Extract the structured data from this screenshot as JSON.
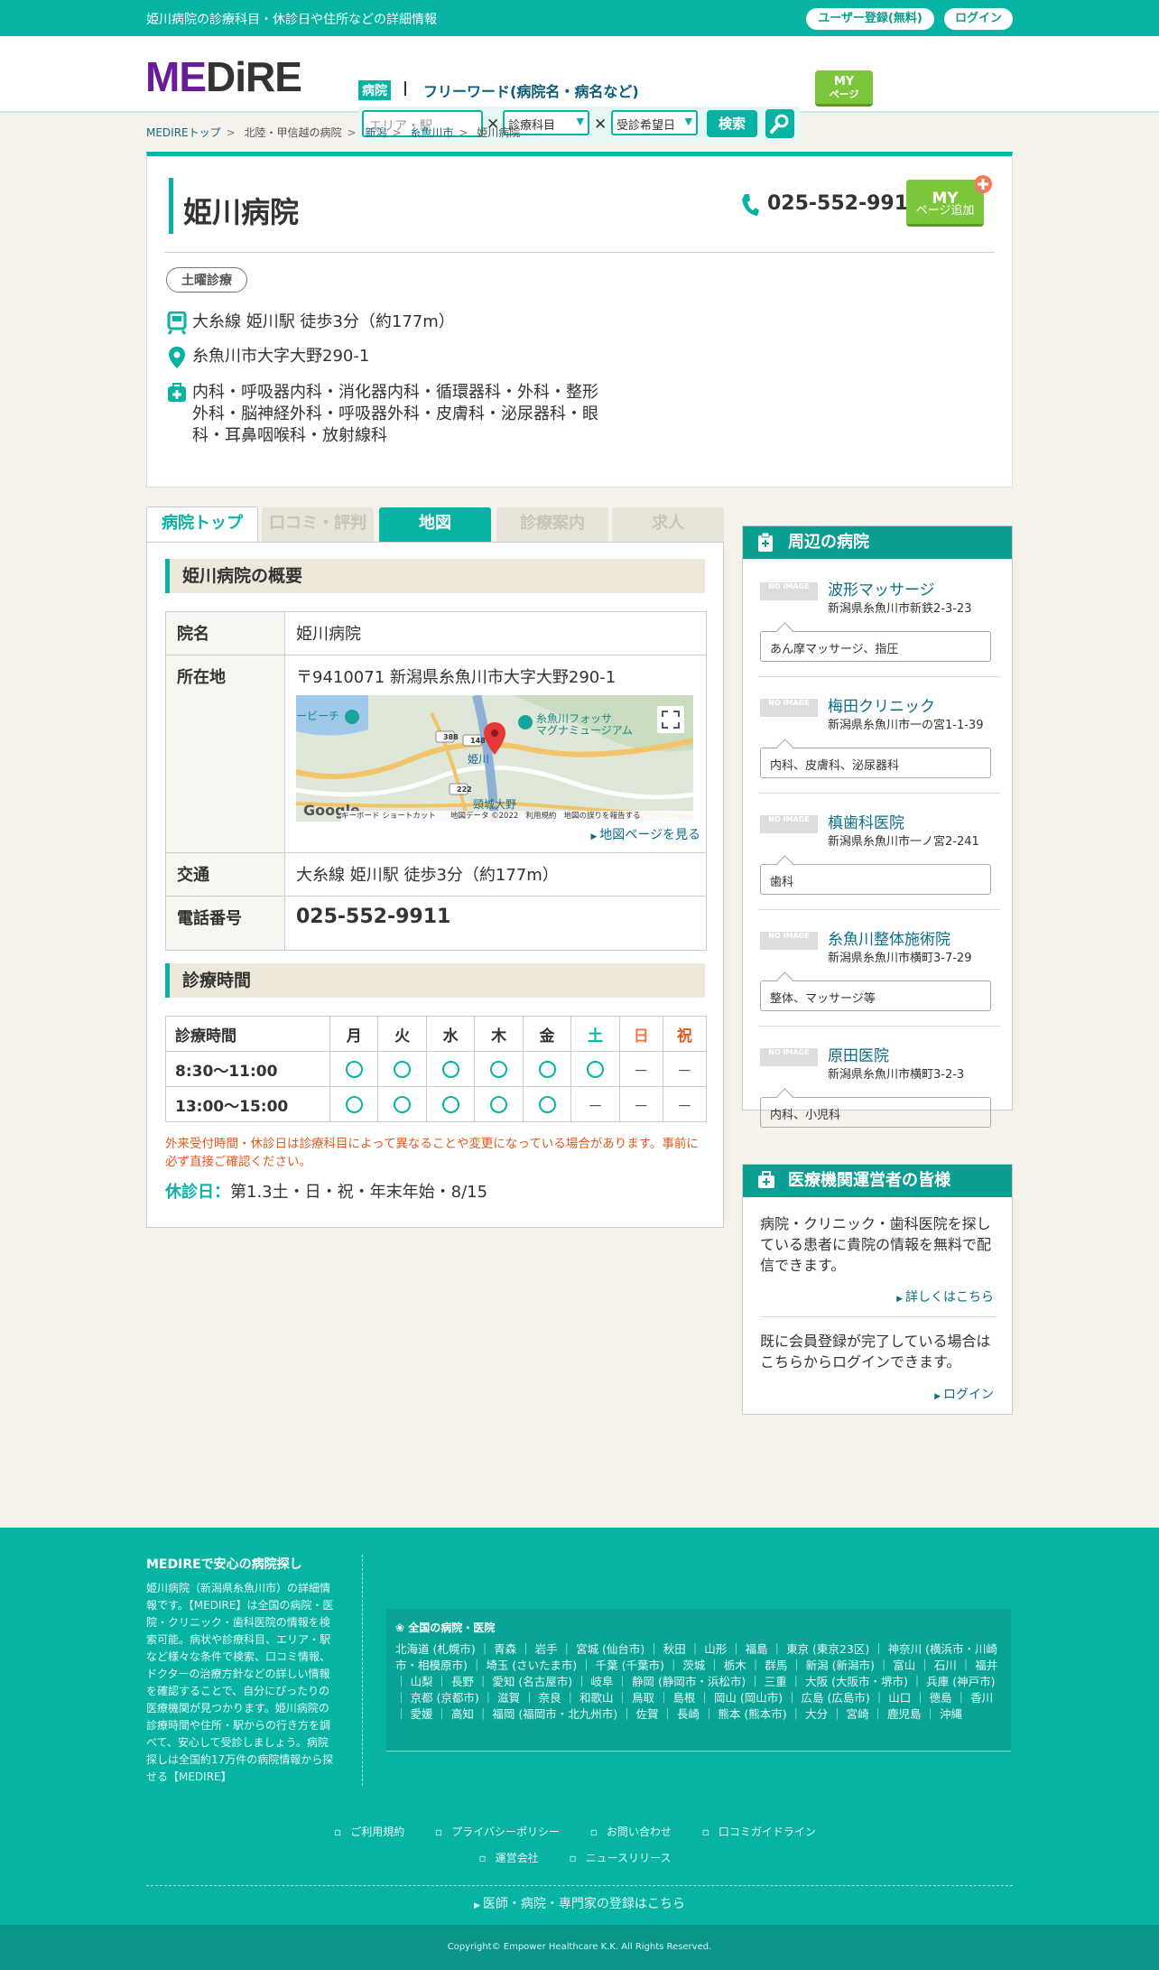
{
  "topbar": {
    "tagline": "姫川病院の診療科目・休診日や住所などの詳細情報",
    "register": "ユーザー登録(無料)",
    "login": "ログイン"
  },
  "header": {
    "logo_a": "ME",
    "logo_b": "DiRE",
    "tab_hospital": "病院",
    "tab_free": "フリーワード(病院名・病名など)",
    "area_placeholder": "エリア・駅",
    "dept_select": "診療科目",
    "date_select": "受診希望日",
    "search_button": "検索",
    "my_a": "MY",
    "my_b": "ページ"
  },
  "breadcrumb": [
    "MEDIREトップ",
    "北陸・甲信越の病院",
    "新潟",
    "糸魚川市",
    "姫川病院"
  ],
  "hospital": {
    "name": "姫川病院",
    "phone": "025-552-9911",
    "my_add_a": "MY",
    "my_add_b": "ページ追加",
    "badge": "土曜診療",
    "access": "大糸線 姫川駅 徒歩3分（約177m）",
    "address_short": "糸魚川市大字大野290-1",
    "departments_1": "内科・呼吸器内科・消化器内科・循環器科・外科・整形",
    "departments_2": "外科・脳神経外科・呼吸器外科・皮膚科・泌尿器科・眼",
    "departments_3": "科・耳鼻咽喉科・放射線科"
  },
  "tabs": [
    "病院トップ",
    "口コミ・評判",
    "地図",
    "診療案内",
    "求人"
  ],
  "overview": {
    "heading": "姫川病院の概要",
    "rows": {
      "name_label": "院名",
      "name_value": "姫川病院",
      "addr_label": "所在地",
      "addr_value": "〒9410071 新潟県糸魚川市大字大野290-1",
      "access_label": "交通",
      "access_value": "大糸線 姫川駅 徒歩3分（約177m）",
      "tel_label": "電話番号",
      "tel_value": "025-552-9911"
    },
    "map": {
      "label_museum_a": "糸魚川フォッサ",
      "label_museum_b": "マグナミュージアム",
      "label_station": "姫川",
      "label_beach": "ービーチ",
      "label_south": "頸城大野",
      "route_a": "388",
      "route_b": "148",
      "route_c": "222",
      "google": "Google",
      "footer_a": "キーボード ショートカット",
      "footer_b": "地図データ ©2022",
      "footer_c": "利用規約",
      "footer_d": "地図の誤りを報告する",
      "link": "地図ページを見る"
    }
  },
  "hours": {
    "heading": "診療時間",
    "header": [
      "診療時間",
      "月",
      "火",
      "水",
      "木",
      "金",
      "土",
      "日",
      "祝"
    ],
    "rows": [
      {
        "time": "8:30～11:00",
        "dash_sun": "－",
        "dash_hol": "－"
      },
      {
        "time": "13:00～15:00",
        "dash_sat": "－",
        "dash_sun": "－",
        "dash_hol": "－"
      }
    ],
    "note": "外来受付時間・休診日は診療科目によって異なることや変更になっている場合があります。事前に必ず直接ご確認ください。",
    "holiday_label": "休診日：",
    "holiday_value": "第1.3土・日・祝・年末年始・8/15"
  },
  "nearby": {
    "heading": "周辺の病院",
    "noimg": "NO IMAGE",
    "items": [
      {
        "name": "波形マッサージ",
        "addr": "新潟県糸魚川市新鉄2-3-23",
        "desc": "あん摩マッサージ、指圧"
      },
      {
        "name": "梅田クリニック",
        "addr": "新潟県糸魚川市一の宮1-1-39",
        "desc": "内科、皮膚科、泌尿器科"
      },
      {
        "name": "槙歯科医院",
        "addr": "新潟県糸魚川市一ノ宮2-241",
        "desc": "歯科"
      },
      {
        "name": "糸魚川整体施術院",
        "addr": "新潟県糸魚川市横町3-7-29",
        "desc": "整体、マッサージ等"
      },
      {
        "name": "原田医院",
        "addr": "新潟県糸魚川市横町3-2-3",
        "desc": "内科、小児科"
      }
    ]
  },
  "operators": {
    "heading": "医療機関運営者の皆様",
    "text1": "病院・クリニック・歯科医院を探している患者に貴院の情報を無料で配信できます。",
    "link1": "詳しくはこちら",
    "text2": "既に会員登録が完了している場合はこちらからログインできます。",
    "link2": "ログイン"
  },
  "footer": {
    "title": "MEDIREで安心の病院探し",
    "body": "姫川病院（新潟県糸魚川市）の詳細情報です。【MEDIRE】は全国の病院・医院・クリニック・歯科医院の情報を検索可能。病状や診療科目、エリア・駅など様々な条件で検索、口コミ情報、ドクターの治療方針などの詳しい情報を確認することで、自分にぴったりの医療機関が見つかります。姫川病院の診療時間や住所・駅からの行き方を調べて、安心して受診しましょう。病院探しは全国約17万件の病院情報から探せる【MEDIRE】",
    "region_title": "全国の病院・医院",
    "regions": "北海道 (札幌市) ｜ 青森 ｜ 岩手 ｜ 宮城 (仙台市) ｜ 秋田 ｜ 山形 ｜ 福島 ｜ 東京 (東京23区) ｜ 神奈川 (横浜市・川崎市・相模原市) ｜ 埼玉 (さいたま市) ｜ 千葉 (千葉市) ｜ 茨城 ｜ 栃木 ｜ 群馬 ｜ 新潟 (新潟市) ｜ 富山 ｜ 石川 ｜ 福井 ｜ 山梨 ｜ 長野 ｜ 愛知 (名古屋市) ｜ 岐阜 ｜ 静岡 (静岡市・浜松市) ｜ 三重 ｜ 大阪 (大阪市・堺市) ｜ 兵庫 (神戸市) ｜ 京都 (京都市) ｜ 滋賀 ｜ 奈良 ｜ 和歌山 ｜ 鳥取 ｜ 島根 ｜ 岡山 (岡山市) ｜ 広島 (広島市) ｜ 山口 ｜ 徳島 ｜ 香川 ｜ 愛媛 ｜ 高知 ｜ 福岡 (福岡市・北九州市) ｜ 佐賀 ｜ 長崎 ｜ 熊本 (熊本市) ｜ 大分 ｜ 宮崎 ｜ 鹿児島 ｜ 沖縄",
    "links1": [
      "ご利用規約",
      "プライバシーポリシー",
      "お問い合わせ",
      "口コミガイドライン"
    ],
    "links2": [
      "運営会社",
      "ニュースリリース"
    ],
    "doctor": "医師・病院・専門家の登録はこちら",
    "copyright": "Copyright© Empower Healthcare K.K. All Rights Reserved."
  },
  "colors": {
    "accent": "#07b3a3",
    "link": "#0b6d8a",
    "warn": "#e25a1c",
    "my_green": "#7cc63a"
  }
}
